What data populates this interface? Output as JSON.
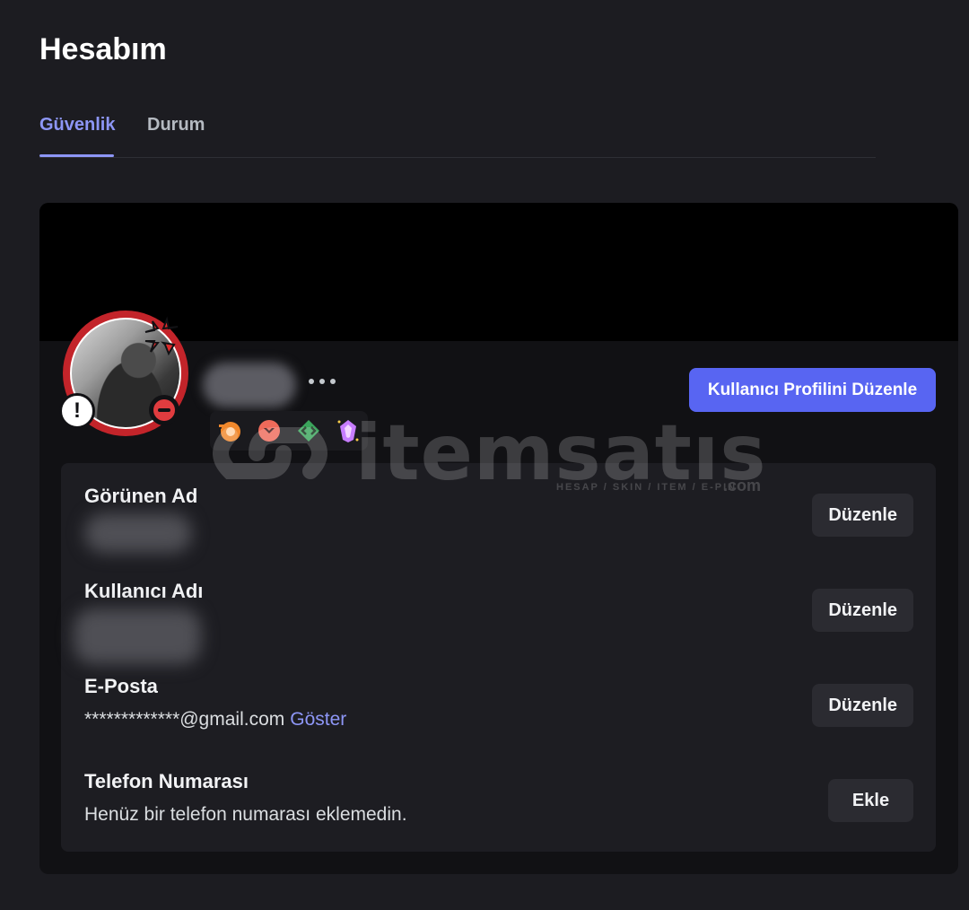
{
  "page": {
    "title": "Hesabım"
  },
  "tabs": [
    {
      "label": "Güvenlik",
      "active": true
    },
    {
      "label": "Durum",
      "active": false
    }
  ],
  "colors": {
    "accent": "#5865f2",
    "tab_active": "#8d96f6",
    "status_dnd": "#e03c3f",
    "avatar_ring": "#c3242a"
  },
  "profile": {
    "edit_button_label": "Kullanıcı Profilini Düzenle",
    "name_redacted": true,
    "more_icon": "more-dots-icon",
    "status": "dnd",
    "badges": [
      {
        "icon": "hypesquad-badge-icon"
      },
      {
        "icon": "quest-badge-icon"
      },
      {
        "icon": "developer-badge-icon"
      },
      {
        "icon": "nitro-gem-badge-icon"
      }
    ]
  },
  "info": {
    "display_name": {
      "label": "Görünen Ad",
      "button": "Düzenle"
    },
    "username": {
      "label": "Kullanıcı Adı",
      "button": "Düzenle"
    },
    "email": {
      "label": "E-Posta",
      "value": "*************@gmail.com",
      "reveal_label": "Göster",
      "button": "Düzenle"
    },
    "phone": {
      "label": "Telefon Numarası",
      "value": "Henüz bir telefon numarası eklemedin.",
      "button": "Ekle"
    }
  },
  "watermark": {
    "text": "itemsatıs",
    "subtext": "HESAP / SKIN / ITEM / E-PIN",
    "suffix": ".com"
  }
}
